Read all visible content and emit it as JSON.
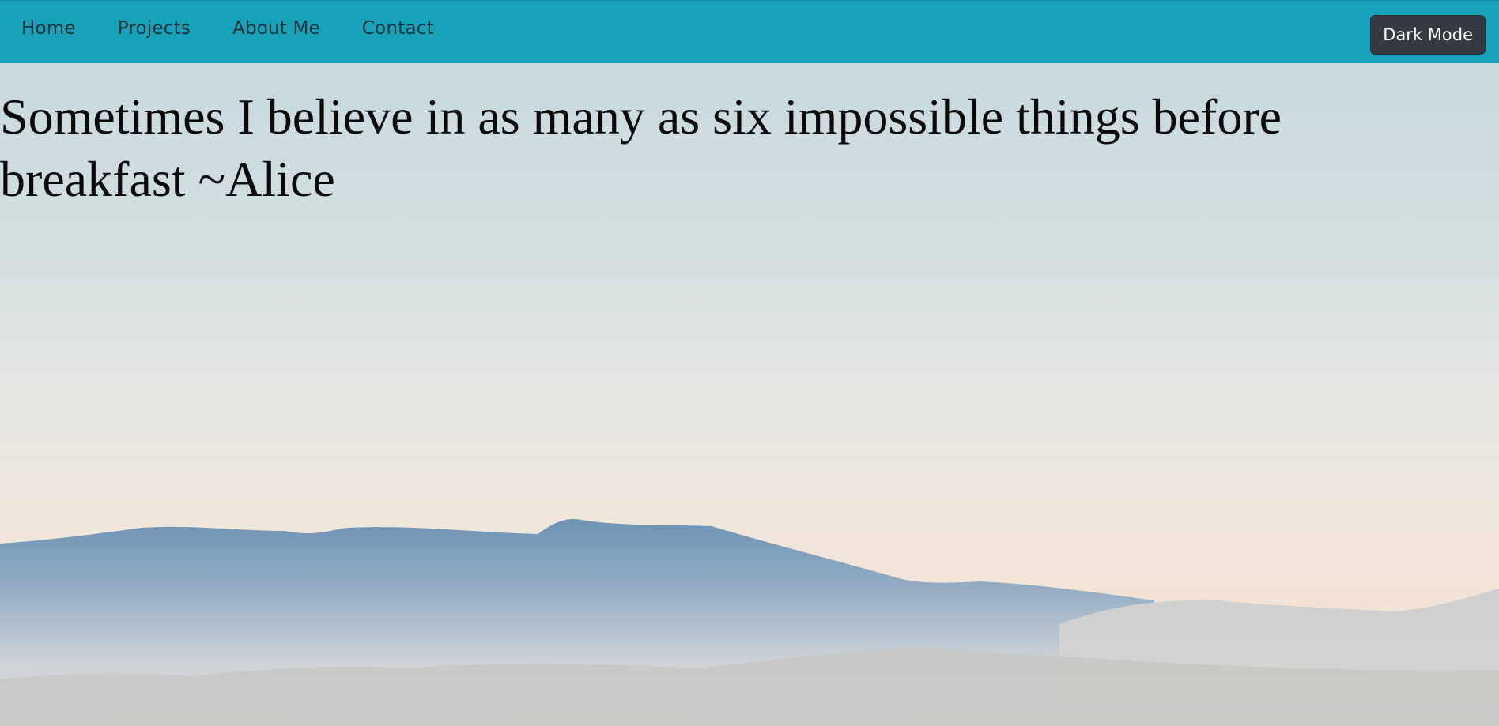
{
  "navbar": {
    "background_color": "#18a2ba",
    "links": [
      {
        "label": "Home"
      },
      {
        "label": "Projects"
      },
      {
        "label": "About Me"
      },
      {
        "label": "Contact"
      }
    ],
    "dark_mode_button": {
      "label": "Dark Mode",
      "color": "#343a40"
    }
  },
  "hero": {
    "quote": "Sometimes I believe in as many as six impossible things before breakfast ~Alice",
    "background_image": "misty-mountains-landscape"
  }
}
